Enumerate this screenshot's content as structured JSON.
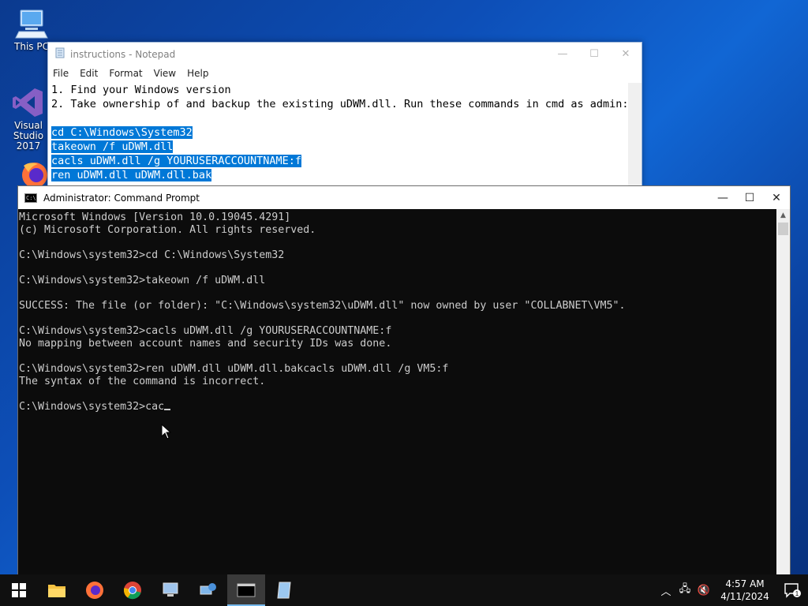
{
  "desktop": {
    "icons": [
      {
        "label": "This PC"
      },
      {
        "label": "Visual Studio",
        "label2": "2017"
      }
    ]
  },
  "notepad": {
    "title": "instructions - Notepad",
    "menu": [
      "File",
      "Edit",
      "Format",
      "View",
      "Help"
    ],
    "lines": [
      "1. Find your Windows version",
      "2. Take ownership of and backup the existing uDWM.dll. Run these commands in cmd as admin:",
      "",
      "cd C:\\Windows\\System32",
      "takeown /f uDWM.dll",
      "cacls uDWM.dll /g YOURUSERACCOUNTNAME:f",
      "ren uDWM.dll uDWM.dll.bak"
    ]
  },
  "cmd": {
    "title": "Administrator: Command Prompt",
    "lines": [
      "Microsoft Windows [Version 10.0.19045.4291]",
      "(c) Microsoft Corporation. All rights reserved.",
      "",
      "C:\\Windows\\system32>cd C:\\Windows\\System32",
      "",
      "C:\\Windows\\system32>takeown /f uDWM.dll",
      "",
      "SUCCESS: The file (or folder): \"C:\\Windows\\system32\\uDWM.dll\" now owned by user \"COLLABNET\\VM5\".",
      "",
      "C:\\Windows\\system32>cacls uDWM.dll /g YOURUSERACCOUNTNAME:f",
      "No mapping between account names and security IDs was done.",
      "",
      "C:\\Windows\\system32>ren uDWM.dll uDWM.dll.bakcacls uDWM.dll /g VM5:f",
      "The syntax of the command is incorrect.",
      ""
    ],
    "prompt_line": "C:\\Windows\\system32>cac"
  },
  "taskbar": {
    "time": "4:57 AM",
    "date": "4/11/2024",
    "notification_count": "1"
  }
}
